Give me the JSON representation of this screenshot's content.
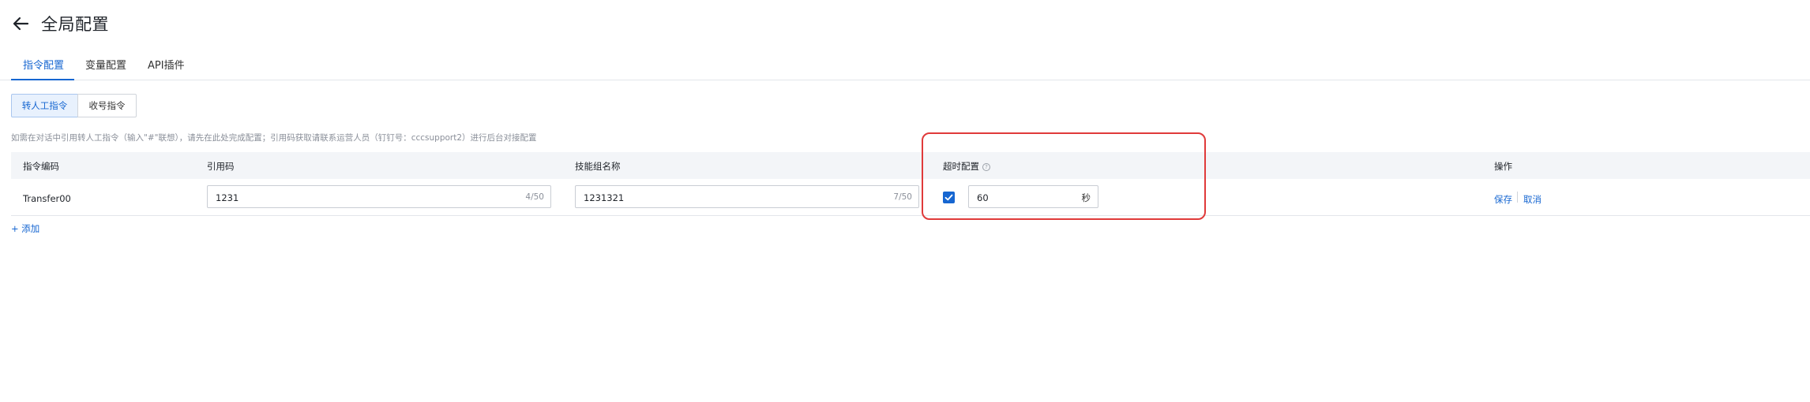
{
  "header": {
    "title": "全局配置",
    "back_icon": "arrow-left-icon"
  },
  "tabs": [
    {
      "label": "指令配置",
      "active": true
    },
    {
      "label": "变量配置",
      "active": false
    },
    {
      "label": "API插件",
      "active": false
    }
  ],
  "segments": [
    {
      "label": "转人工指令",
      "active": true
    },
    {
      "label": "收号指令",
      "active": false
    }
  ],
  "hint": "如需在对话中引用转人工指令（输入\"#\"联想），请先在此处完成配置；引用码获取请联系运营人员（钉钉号：cccsupport2）进行后台对接配置",
  "table": {
    "columns": {
      "code": "指令编码",
      "ref": "引用码",
      "skill": "技能组名称",
      "timeout": "超时配置",
      "ops": "操作"
    },
    "timeout_help_icon": "help-circle-icon",
    "row": {
      "code": "Transfer00",
      "ref_value": "1231",
      "ref_count": "4/50",
      "skill_value": "1231321",
      "skill_count": "7/50",
      "timeout_checked": true,
      "timeout_value": "60",
      "timeout_unit": "秒",
      "save_label": "保存",
      "cancel_label": "取消"
    }
  },
  "add_label": "+ 添加",
  "colors": {
    "accent": "#1666d1",
    "highlight": "#e03a3a"
  }
}
